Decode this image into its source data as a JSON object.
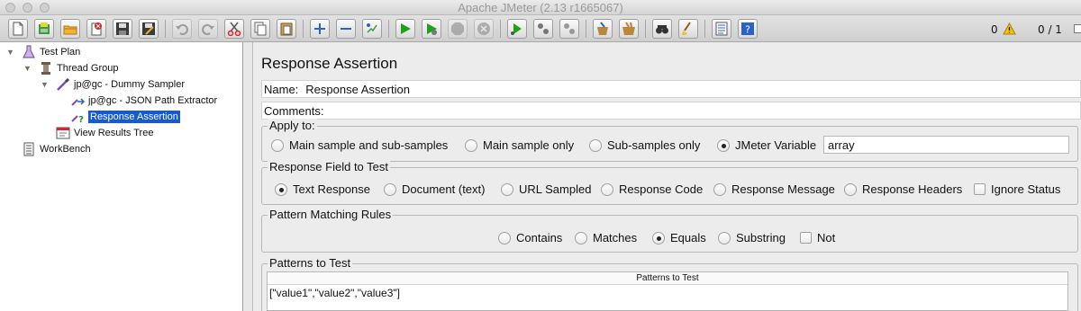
{
  "window": {
    "title": "Apache JMeter (2.13 r1665067)"
  },
  "toolbar": {
    "buttons": [
      {
        "name": "new-icon"
      },
      {
        "name": "templates-icon"
      },
      {
        "name": "open-icon"
      },
      {
        "name": "close-icon"
      },
      {
        "name": "save-icon"
      },
      {
        "name": "save-as-icon"
      },
      {
        "name": "undo-icon"
      },
      {
        "name": "redo-icon"
      },
      {
        "name": "cut-icon"
      },
      {
        "name": "copy-icon"
      },
      {
        "name": "paste-icon"
      },
      {
        "name": "expand-icon"
      },
      {
        "name": "collapse-icon"
      },
      {
        "name": "toggle-icon"
      },
      {
        "name": "start-icon"
      },
      {
        "name": "start-no-timers-icon"
      },
      {
        "name": "stop-icon"
      },
      {
        "name": "shutdown-icon"
      },
      {
        "name": "remote-start-icon"
      },
      {
        "name": "remote-stop-icon"
      },
      {
        "name": "remote-shutdown-icon"
      },
      {
        "name": "clear-icon"
      },
      {
        "name": "clear-all-icon"
      },
      {
        "name": "search-icon"
      },
      {
        "name": "reset-search-icon"
      },
      {
        "name": "function-helper-icon"
      },
      {
        "name": "help-icon"
      }
    ],
    "error_count": "0",
    "thread_count": "0 / 1"
  },
  "tree": {
    "nodes": [
      {
        "label": "Test Plan",
        "icon": "flask-icon"
      },
      {
        "label": "Thread Group",
        "icon": "spool-icon"
      },
      {
        "label": "jp@gc - Dummy Sampler",
        "icon": "pipette-icon"
      },
      {
        "label": "jp@gc - JSON Path Extractor",
        "icon": "extractor-icon"
      },
      {
        "label": "Response Assertion",
        "icon": "assertion-icon"
      },
      {
        "label": "View Results Tree",
        "icon": "listener-icon"
      },
      {
        "label": "WorkBench",
        "icon": "workbench-icon"
      }
    ]
  },
  "panel": {
    "title": "Response Assertion",
    "name_label": "Name:",
    "name_value": "Response Assertion",
    "comments_label": "Comments:",
    "apply_to": {
      "legend": "Apply to:",
      "options": [
        "Main sample and sub-samples",
        "Main sample only",
        "Sub-samples only",
        "JMeter Variable"
      ],
      "selected": "JMeter Variable",
      "variable_value": "array"
    },
    "field_to_test": {
      "legend": "Response Field to Test",
      "options": [
        "Text Response",
        "Document (text)",
        "URL Sampled",
        "Response Code",
        "Response Message",
        "Response Headers"
      ],
      "selected": "Text Response",
      "ignore_status_label": "Ignore Status",
      "ignore_status": false
    },
    "pattern_rules": {
      "legend": "Pattern Matching Rules",
      "options": [
        "Contains",
        "Matches",
        "Equals",
        "Substring"
      ],
      "selected": "Equals",
      "not_label": "Not",
      "not": false
    },
    "patterns": {
      "legend": "Patterns to Test",
      "column_header": "Patterns to Test",
      "rows": [
        "[\"value1\",\"value2\",\"value3\"]"
      ]
    }
  },
  "colors": {
    "selection": "#1459d6",
    "run_green": "#1ea21e",
    "warning": "#f5c400"
  }
}
